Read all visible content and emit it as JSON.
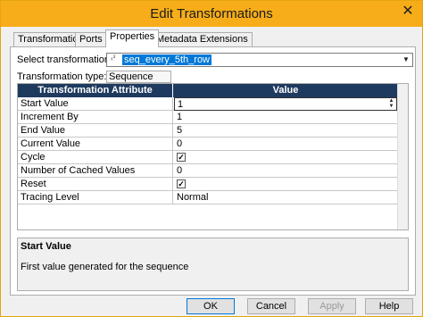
{
  "window": {
    "title": "Edit Transformations",
    "close_glyph": "✕"
  },
  "tabs": [
    {
      "label": "Transformation"
    },
    {
      "label": "Ports"
    },
    {
      "label": "Properties"
    },
    {
      "label": "Metadata Extensions"
    }
  ],
  "select_transformation": {
    "label": "Select transformation:",
    "value": "seq_every_5th_row",
    "icon": "sequence-icon"
  },
  "transformation_type": {
    "label": "Transformation type:",
    "value": "Sequence"
  },
  "grid": {
    "columns": [
      "Transformation Attribute",
      "Value"
    ],
    "rows": [
      {
        "attribute": "Start Value",
        "value": "1"
      },
      {
        "attribute": "Increment By",
        "value": "1"
      },
      {
        "attribute": "End Value",
        "value": "5"
      },
      {
        "attribute": "Current Value",
        "value": "0"
      },
      {
        "attribute": "Cycle",
        "value": "✓"
      },
      {
        "attribute": "Number of Cached Values",
        "value": "0"
      },
      {
        "attribute": "Reset",
        "value": "✓"
      },
      {
        "attribute": "Tracing Level",
        "value": "Normal"
      }
    ]
  },
  "description": {
    "title": "Start Value",
    "text": "First value generated for the sequence"
  },
  "buttons": {
    "ok": "OK",
    "cancel": "Cancel",
    "apply": "Apply",
    "help": "Help"
  },
  "colors": {
    "titlebar": "#f6ad19",
    "grid_header": "#1f3a5f",
    "selection": "#0078d7"
  }
}
